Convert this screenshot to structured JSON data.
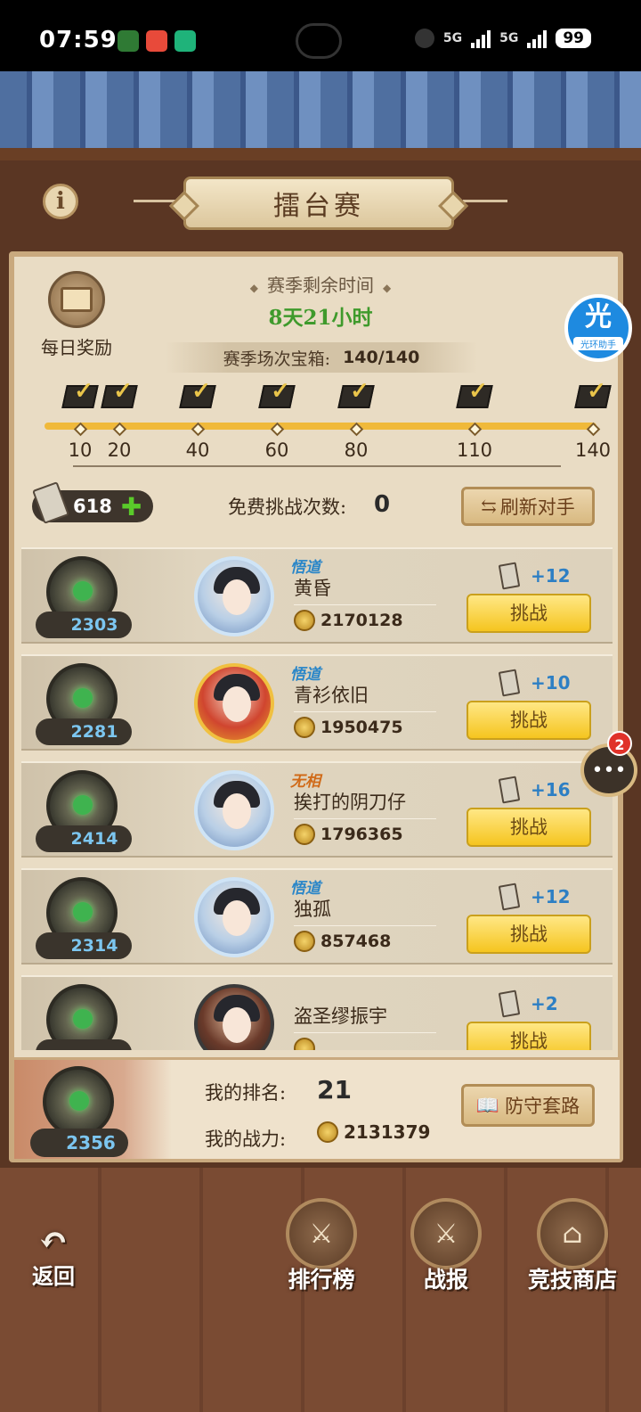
{
  "status_bar": {
    "time": "07:59",
    "network_1": "5G",
    "network_2": "5G",
    "battery": "99"
  },
  "header": {
    "title": "擂台赛",
    "info_icon": "info-icon"
  },
  "season": {
    "daily_reward_label": "每日奖励",
    "remaining_title": "赛季剩余时间",
    "remaining_value": "8天21小时",
    "chest_label": "赛季场次宝箱:",
    "chest_count": "140/140",
    "milestones": [
      "10",
      "20",
      "40",
      "60",
      "80",
      "110",
      "140"
    ],
    "milestone_progress": 1.0
  },
  "floating": {
    "helper_big": "光",
    "helper_small": "光环助手",
    "chat_badge": "2"
  },
  "controls": {
    "tickets": "618",
    "free_label": "免费挑战次数:",
    "free_value": "0",
    "refresh_label": "刷新对手"
  },
  "opponents": [
    {
      "rank_score": "2303",
      "title": "悟道",
      "name": "黄昏",
      "power": "2170128",
      "gain": "+12",
      "button": "挑战"
    },
    {
      "rank_score": "2281",
      "title": "悟道",
      "name": "青衫依旧",
      "power": "1950475",
      "gain": "+10",
      "button": "挑战"
    },
    {
      "rank_score": "2414",
      "title": "无相",
      "name": "挨打的阴刀仔",
      "power": "1796365",
      "gain": "+16",
      "button": "挑战"
    },
    {
      "rank_score": "2314",
      "title": "悟道",
      "name": "独孤",
      "power": "857468",
      "gain": "+12",
      "button": "挑战"
    },
    {
      "rank_score": "",
      "title": "",
      "name": "盗圣缪振宇",
      "power": "",
      "gain": "+2",
      "button": "挑战"
    }
  ],
  "me": {
    "rank_score": "2356",
    "rank_label": "我的排名:",
    "rank_value": "21",
    "power_label": "我的战力:",
    "power_value": "2131379",
    "defense_label": "防守套路"
  },
  "nav": {
    "back": "返回",
    "leaderboard": "排行榜",
    "battle_report": "战报",
    "shop": "竞技商店"
  }
}
